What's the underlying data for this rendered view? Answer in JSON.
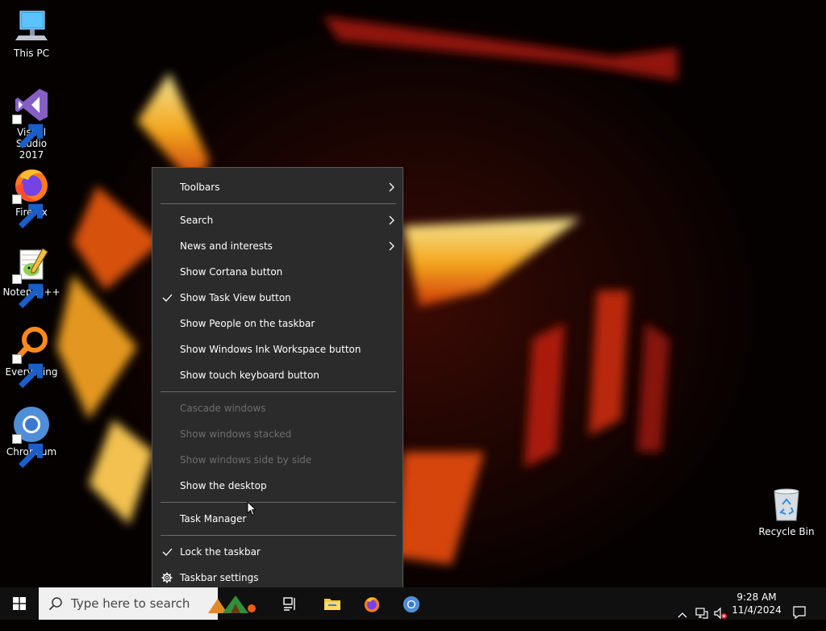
{
  "desktop": {
    "icons": [
      {
        "label": "This PC",
        "icon": "computer-icon"
      },
      {
        "label": "Visual Studio\n2017",
        "line1": "Visual Studio",
        "line2": "2017",
        "icon": "visual-studio-icon"
      },
      {
        "label": "Firefox",
        "icon": "firefox-icon"
      },
      {
        "label": "Notepad++",
        "icon": "notepad-plus-plus-icon"
      },
      {
        "label": "Everything",
        "icon": "everything-search-icon"
      },
      {
        "label": "Chromium",
        "icon": "chromium-icon"
      },
      {
        "label": "Recycle Bin",
        "icon": "recycle-bin-icon"
      }
    ]
  },
  "context_menu": {
    "items": [
      {
        "label": "Toolbars",
        "submenu": true
      },
      {
        "label": "Search",
        "submenu": true
      },
      {
        "label": "News and interests",
        "submenu": true
      },
      {
        "label": "Show Cortana button"
      },
      {
        "label": "Show Task View button",
        "checked": true
      },
      {
        "label": "Show People on the taskbar"
      },
      {
        "label": "Show Windows Ink Workspace button"
      },
      {
        "label": "Show touch keyboard button"
      },
      {
        "label": "Cascade windows",
        "disabled": true
      },
      {
        "label": "Show windows stacked",
        "disabled": true
      },
      {
        "label": "Show windows side by side",
        "disabled": true
      },
      {
        "label": "Show the desktop"
      },
      {
        "label": "Task Manager"
      },
      {
        "label": "Lock the taskbar",
        "checked": true
      },
      {
        "label": "Taskbar settings",
        "icon": "gear-icon"
      }
    ]
  },
  "taskbar": {
    "search_placeholder": "Type here to search",
    "pinned": [
      "task-view-icon",
      "file-explorer-icon",
      "firefox-icon",
      "chromium-icon"
    ],
    "clock_time": "9:28 AM",
    "clock_date": "11/4/2024"
  },
  "colors": {
    "menu_bg": "#2b2b2b",
    "menu_text": "#ffffff",
    "menu_disabled": "#6d6d6d",
    "taskbar_bg": "#101010"
  }
}
